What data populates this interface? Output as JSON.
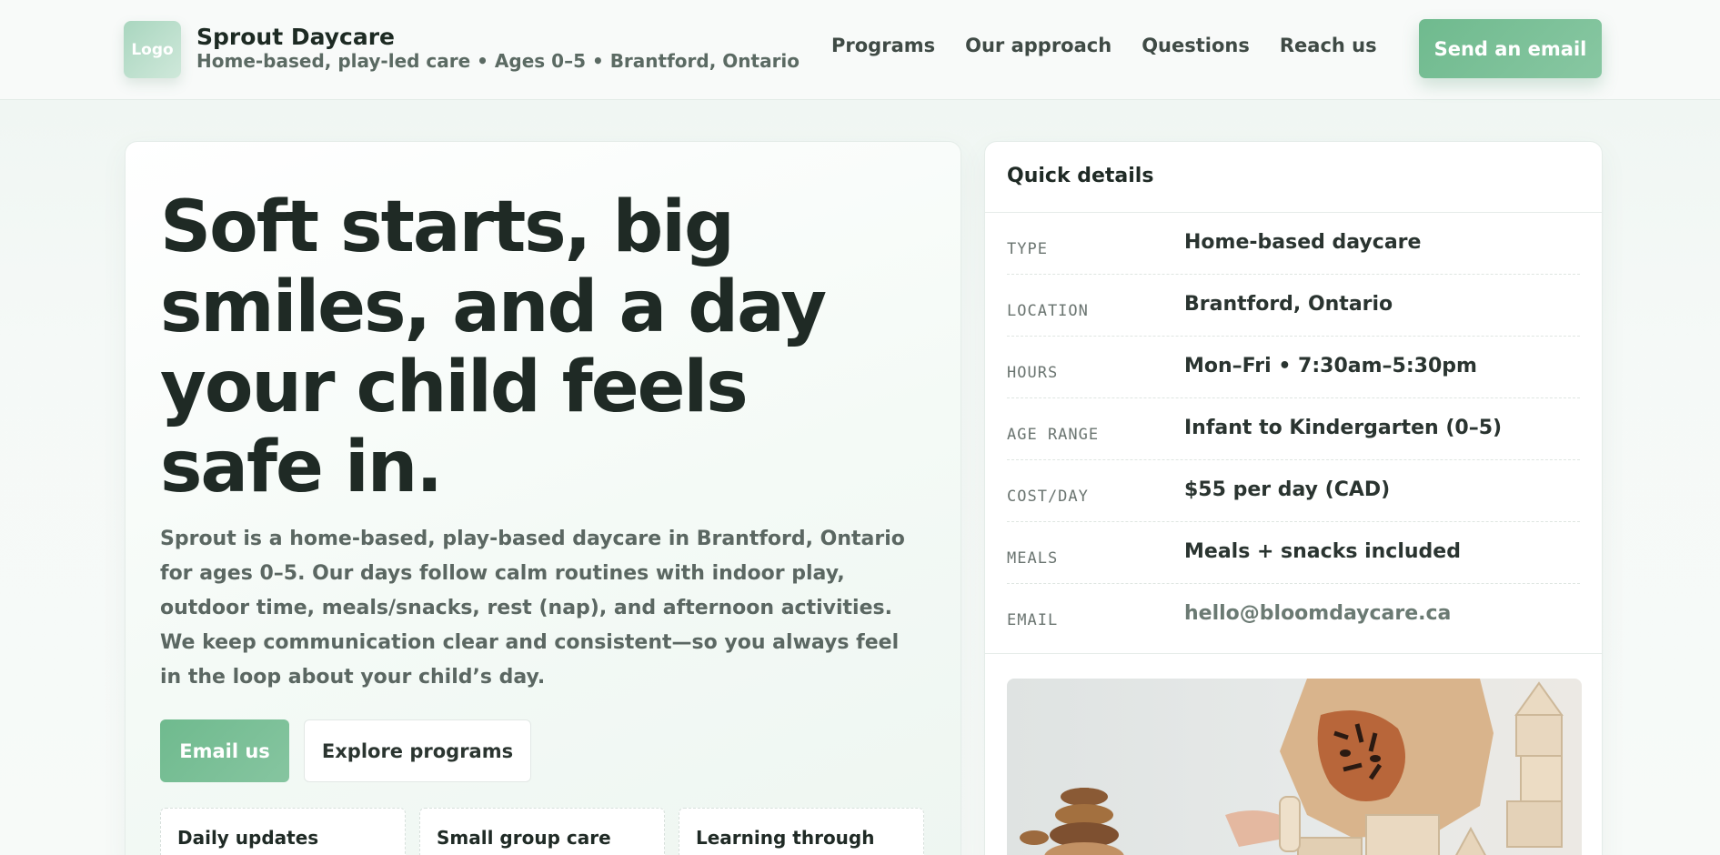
{
  "header": {
    "logo_text": "Logo",
    "brand_name": "Sprout Daycare",
    "tagline": "Home-based, play-led care • Ages 0–5 • Brantford, Ontario",
    "nav": [
      "Programs",
      "Our approach",
      "Questions",
      "Reach us"
    ],
    "cta": "Send an email"
  },
  "hero": {
    "title": "Soft starts, big smiles, and a day your child feels safe in.",
    "description": "Sprout is a home-based, play-based daycare in Brantford, Ontario for ages 0–5. Our days follow calm routines with indoor play, outdoor time, meals/snacks, rest (nap), and afternoon activities. We keep communication clear and consistent—so you always feel in the loop about your child’s day.",
    "primary_button": "Email us",
    "secondary_button": "Explore programs",
    "features": [
      "Daily updates",
      "Small group care",
      "Learning through"
    ]
  },
  "details": {
    "title": "Quick details",
    "rows": [
      {
        "key": "TYPE",
        "value": "Home-based daycare"
      },
      {
        "key": "LOCATION",
        "value": "Brantford, Ontario"
      },
      {
        "key": "HOURS",
        "value": "Mon–Fri • 7:30am–5:30pm"
      },
      {
        "key": "AGE RANGE",
        "value": "Infant to Kindergarten (0–5)"
      },
      {
        "key": "COST/DAY",
        "value": "$55 per day (CAD)"
      },
      {
        "key": "MEALS",
        "value": "Meals + snacks included"
      },
      {
        "key": "EMAIL",
        "value": "hello@bloomdaycare.ca"
      }
    ]
  },
  "colors": {
    "accent": "#6fba8e",
    "heading": "#1f2a25",
    "muted": "#5b6762"
  }
}
